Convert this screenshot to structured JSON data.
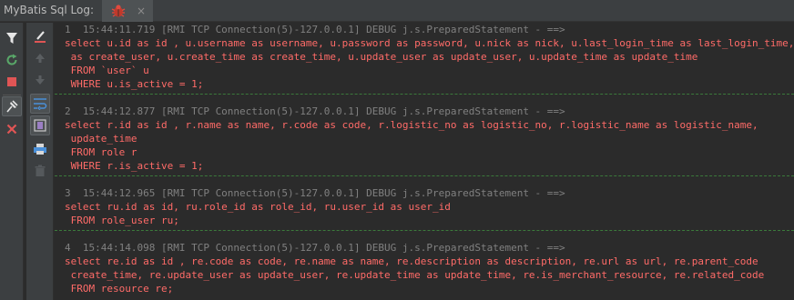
{
  "window": {
    "title": "MyBatis Sql Log:"
  },
  "tab": {
    "icon": "bug-icon",
    "close_label": "×"
  },
  "toolbar_left": [
    {
      "name": "filter-icon",
      "active": false
    },
    {
      "name": "rerun-icon",
      "active": false
    },
    {
      "name": "stop-icon",
      "active": false
    },
    {
      "name": "pin-icon",
      "active": true
    },
    {
      "name": "close-icon",
      "active": false
    }
  ],
  "toolbar_right": [
    {
      "name": "clear-all-icon",
      "active": false
    },
    {
      "name": "arrow-up-icon",
      "active": false
    },
    {
      "name": "arrow-down-icon",
      "active": false
    },
    {
      "name": "soft-wrap-icon",
      "active": true
    },
    {
      "name": "scroll-to-end-icon",
      "active": true
    },
    {
      "name": "print-icon",
      "active": false
    },
    {
      "name": "trash-icon",
      "active": false
    }
  ],
  "colors": {
    "sql_text": "#ff6b68",
    "header_text": "#808080",
    "separator": "#3b7a3b",
    "background": "#2b2b2b"
  },
  "log_entries": [
    {
      "header": "1  15:44:11.719 [RMI TCP Connection(5)-127.0.0.1] DEBUG j.s.PreparedStatement - ==>",
      "lines": [
        "select u.id as id , u.username as username, u.password as password, u.nick as nick, u.last_login_time as last_login_time,",
        " as create_user, u.create_time as create_time, u.update_user as update_user, u.update_time as update_time",
        " FROM `user` u",
        " WHERE u.is_active = 1;"
      ]
    },
    {
      "header": "2  15:44:12.877 [RMI TCP Connection(5)-127.0.0.1] DEBUG j.s.PreparedStatement - ==>",
      "lines": [
        "select r.id as id , r.name as name, r.code as code, r.logistic_no as logistic_no, r.logistic_name as logistic_name,",
        " update_time",
        " FROM role r",
        " WHERE r.is_active = 1;"
      ]
    },
    {
      "header": "3  15:44:12.965 [RMI TCP Connection(5)-127.0.0.1] DEBUG j.s.PreparedStatement - ==>",
      "lines": [
        "select ru.id as id, ru.role_id as role_id, ru.user_id as user_id",
        " FROM role_user ru;"
      ]
    },
    {
      "header": "4  15:44:14.098 [RMI TCP Connection(5)-127.0.0.1] DEBUG j.s.PreparedStatement - ==>",
      "lines": [
        "select re.id as id , re.code as code, re.name as name, re.description as description, re.url as url, re.parent_code",
        " create_time, re.update_user as update_user, re.update_time as update_time, re.is_merchant_resource, re.related_code",
        " FROM resource re;"
      ]
    }
  ]
}
